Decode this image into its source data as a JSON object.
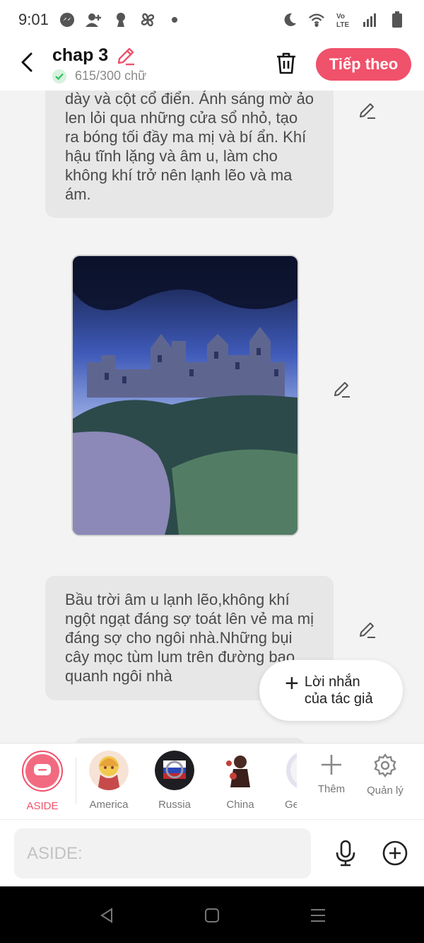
{
  "status_bar": {
    "time": "9:01"
  },
  "header": {
    "title": "chap 3",
    "word_count": "615/300 chữ",
    "next_label": "Tiếp theo"
  },
  "content": {
    "bubble_1_text": "dày và cột cổ điển. Ánh sáng mờ ảo len lỏi qua những cửa sổ nhỏ, tạo ra bóng tối đầy ma mị và bí ẩn. Khí hậu tĩnh lặng và âm u, làm cho không khí trở nên lạnh lẽo và ma ám.",
    "bubble_2_text": "Bầu trời âm u lạnh lẽo,không khí ngột ngạt đáng sợ toát lên vẻ ma mị đáng sợ cho ngôi nhà.Những bụi cây mọc tùm lum trên đường bao quanh ngôi nhà",
    "fab_label": "Lời nhắn của tác giả"
  },
  "characters": [
    {
      "name": "ASIDE",
      "active": true
    },
    {
      "name": "America"
    },
    {
      "name": "Russia"
    },
    {
      "name": "China"
    },
    {
      "name": "Ge"
    }
  ],
  "tools": {
    "add_label": "Thêm",
    "manage_label": "Quản lý"
  },
  "input": {
    "placeholder": "ASIDE:"
  },
  "colors": {
    "accent": "#f0516b",
    "bubble": "#e7e7e7",
    "background": "#f3f3f3"
  }
}
